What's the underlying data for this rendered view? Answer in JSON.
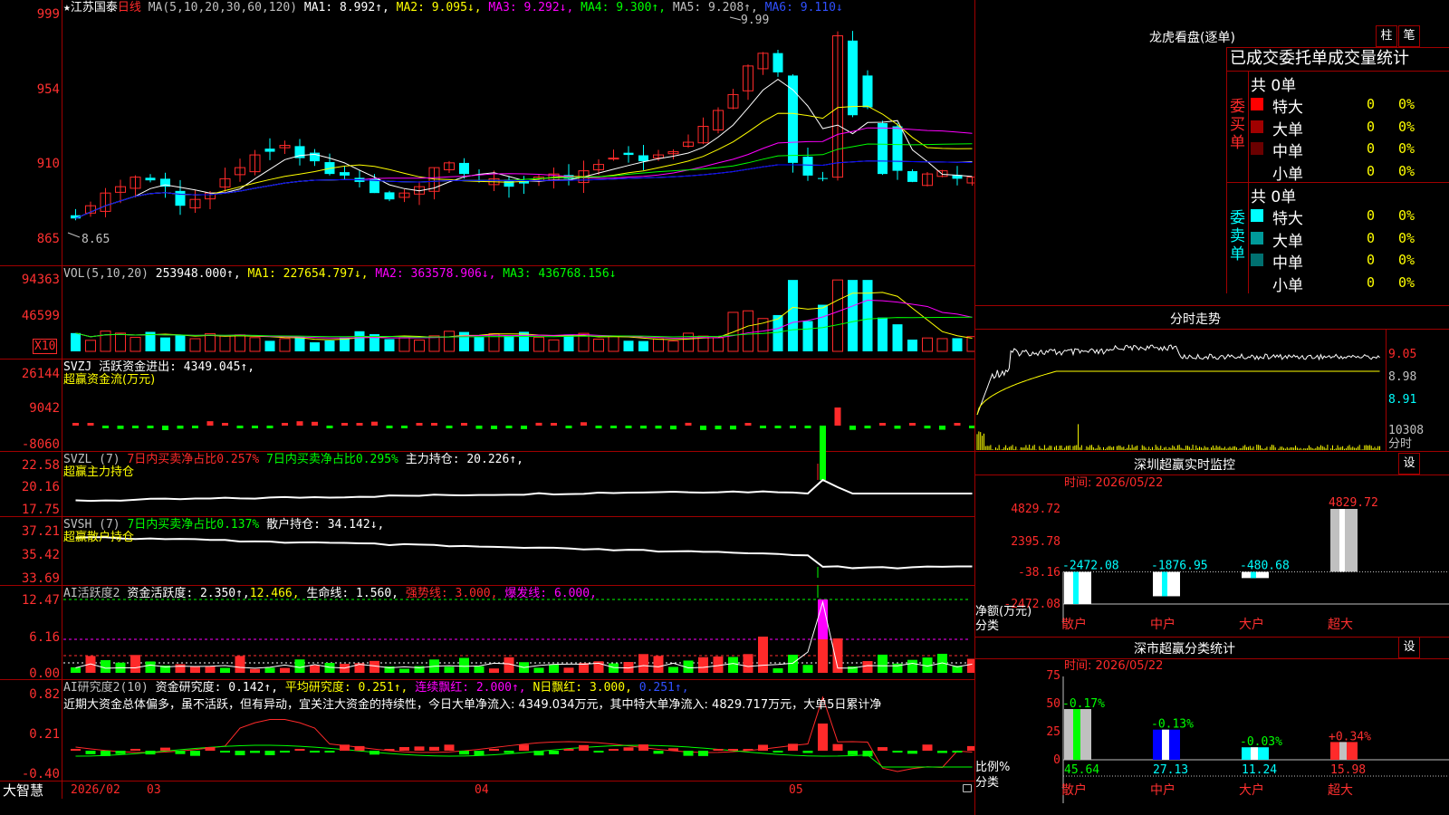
{
  "colors": {
    "up": "#ff2a2a",
    "down": "#00ffff",
    "ma1": "#ffffff",
    "ma2": "#ffff00",
    "ma3": "#ff00ff",
    "ma4": "#00ff00",
    "ma5": "#c0c0c0",
    "ma6": "#0000ff",
    "green": "#00ff00",
    "yellow": "#ffff00",
    "magenta": "#ff00ff",
    "frame": "#a00000"
  },
  "header": {
    "star": "★",
    "stock": "江苏国泰",
    "period": "日线",
    "ma_params": "MA(5,10,20,30,60,120)",
    "ma1": "MA1: 8.992↑,",
    "ma2": "MA2: 9.095↓,",
    "ma3": "MA3: 9.292↓,",
    "ma4": "MA4: 9.300↑,",
    "ma5": "MA5: 9.208↑,",
    "ma6": "MA6: 9.110↓",
    "high_mark": "9.99",
    "low_mark": "8.65"
  },
  "price_axis": [
    "999",
    "954",
    "910",
    "865"
  ],
  "vol": {
    "label": "VOL(5,10,20)",
    "value": "253948.000↑,",
    "ma1": "MA1: 227654.797↓,",
    "ma2": "MA2: 363578.906↓,",
    "ma3": "MA3: 436768.156↓",
    "axis": [
      "94363",
      "46599"
    ],
    "unit": "X10"
  },
  "svzj": {
    "label": "SVZJ  活跃资金进出: 4349.045↑,",
    "title": "超赢资金流(万元)",
    "axis": [
      "26144",
      "9042",
      "-8060"
    ]
  },
  "svzl": {
    "label": "SVZL (7)",
    "a": "7日内买卖净占比0.257%",
    "b": "7日内买卖净占比0.295%",
    "c": "主力持仓: 20.226↑,",
    "title": "超赢主力持仓",
    "axis": [
      "22.58",
      "20.16",
      "17.75"
    ]
  },
  "svsh": {
    "label": "SVSH (7)",
    "a": "7日内买卖净占比0.137%",
    "b": "散户持仓: 34.142↓,",
    "title": "超赢散户持仓",
    "axis": [
      "37.21",
      "35.42",
      "33.69"
    ]
  },
  "ai1": {
    "label": "AI活跃度2",
    "a": "资金活跃度: 2.350↑,",
    "b": "12.466,",
    "c": "生命线: 1.560,",
    "d": "强势线: 3.000,",
    "e": "爆发线: 6.000,",
    "axis": [
      "12.47",
      "6.16",
      "0.00"
    ]
  },
  "ai2": {
    "label": "AI研究度2(10)",
    "a": "资金研究度: 0.142↑,",
    "b": "平均研究度: 0.251↑,",
    "c": "连续飘红: 2.000↑,",
    "d": "N日飘红: 3.000,",
    "e": "0.251↑,",
    "desc": "近期大资金总体偏多，虽不活跃，但有异动，宜关注大资金的持续性，今日大单净流入: 4349.034万元，其中特大单净流入: 4829.717万元，大单5日累计净",
    "axis": [
      "0.82",
      "0.21",
      "-0.40"
    ]
  },
  "footer": {
    "brand": "大智慧",
    "d1": "2026/02",
    "d2": "03",
    "d3": "04",
    "d4": "05"
  },
  "dragon": {
    "title": "龙虎看盘(逐单)",
    "btn1": "柱",
    "btn2": "笔",
    "header": "已成交委托单成交量统计",
    "buy": {
      "side": "委买单",
      "total": "共 0单",
      "rows": [
        {
          "name": "特大",
          "n": "0",
          "p": "0%",
          "c": "#ff0000"
        },
        {
          "name": "大单",
          "n": "0",
          "p": "0%",
          "c": "#a00000"
        },
        {
          "name": "中单",
          "n": "0",
          "p": "0%",
          "c": "#6a0000"
        },
        {
          "name": "小单",
          "n": "0",
          "p": "0%",
          "c": ""
        }
      ]
    },
    "sell": {
      "side": "委卖单",
      "total": "共 0单",
      "rows": [
        {
          "name": "特大",
          "n": "0",
          "p": "0%",
          "c": "#00ffff"
        },
        {
          "name": "大单",
          "n": "0",
          "p": "0%",
          "c": "#009a9a"
        },
        {
          "name": "中单",
          "n": "0",
          "p": "0%",
          "c": "#007070"
        },
        {
          "name": "小单",
          "n": "0",
          "p": "0%",
          "c": ""
        }
      ]
    }
  },
  "intraday": {
    "title": "分时走势",
    "axis": [
      "9.05",
      "8.98",
      "8.91"
    ],
    "vol_label": "10308",
    "unit": "分时"
  },
  "monitor": {
    "title": "深圳超赢实时监控",
    "btn": "设",
    "time": "时间: 2026/05/22",
    "yunit": "净额(万元)",
    "xunit": "分类",
    "axis": [
      "4829.72",
      "2395.78",
      "-38.16",
      "-2472.08"
    ],
    "chart_data": {
      "type": "bar",
      "categories": [
        "散户",
        "中户",
        "大户",
        "超大"
      ],
      "values": [
        -2472.08,
        -1876.95,
        -480.68,
        4829.72
      ],
      "ylim": [
        -2472.08,
        4829.72
      ]
    }
  },
  "classify": {
    "title": "深市超赢分类统计",
    "btn": "设",
    "time": "时间: 2026/05/22",
    "yunit": "比例%",
    "xunit": "分类",
    "axis": [
      "75",
      "50",
      "25",
      "0"
    ],
    "chart_data": {
      "type": "bar",
      "categories": [
        "散户",
        "中户",
        "大户",
        "超大"
      ],
      "values": [
        45.64,
        27.13,
        11.24,
        15.98
      ],
      "changes": [
        "-0.17%",
        "-0.13%",
        "-0.03%",
        "+0.34%"
      ],
      "ylim": [
        0,
        75
      ]
    }
  }
}
